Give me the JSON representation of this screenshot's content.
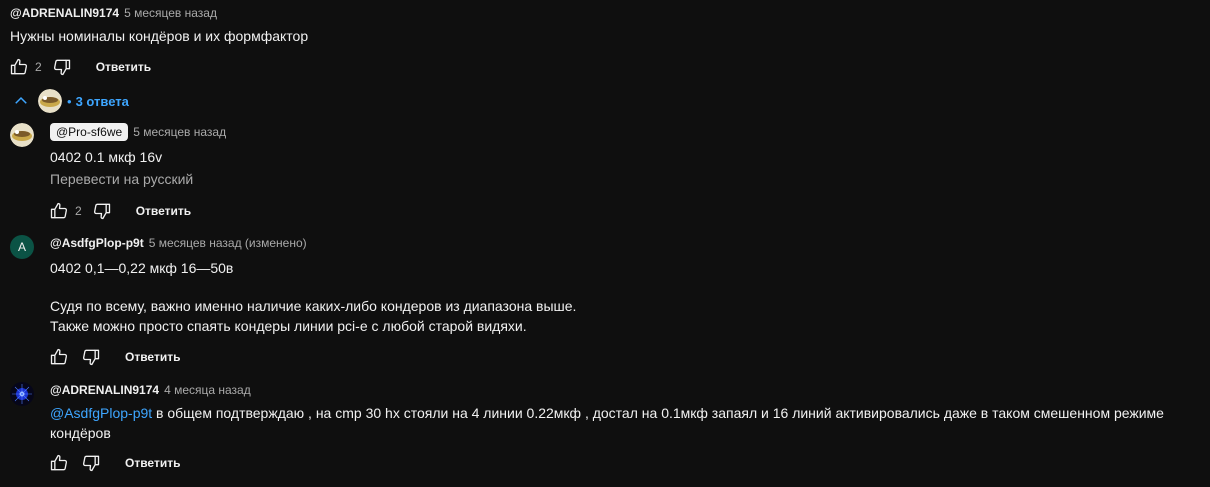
{
  "comment": {
    "author": "@ADRENALIN9174",
    "time": "5 месяцев назад",
    "text": "Нужны номиналы кондёров и их формфактор",
    "likes": "2",
    "reply_label": "Ответить"
  },
  "replies_toggle": {
    "bullet": "•",
    "label": "3 ответа"
  },
  "replies": [
    {
      "author": "@Pro-sf6we",
      "time": "5 месяцев назад",
      "text": "0402 0.1 мкф 16v",
      "translate": "Перевести на русский",
      "likes": "2",
      "reply_label": "Ответить"
    },
    {
      "avatar_letter": "A",
      "author": "@AsdfgPlop-p9t",
      "time": "5 месяцев назад (изменено)",
      "lines": [
        "0402 0,1—0,22 мкф 16—50в",
        "Судя по всему, важно именно наличие каких-либо кондеров из диапазона выше.",
        "Также можно просто спаять кондеры линии pci-e с любой старой видяхи."
      ],
      "reply_label": "Ответить"
    },
    {
      "author": "@ADRENALIN9174",
      "time": "4 месяца назад",
      "mention": "@AsdfgPlop-p9t",
      "text_line1": " в общем подтверждаю , на cmp 30 hx стояли на 4 линии 0.22мкф , достал на 0.1мкф запаял и 16 линий активировались  даже в таком смешенном режиме",
      "text_line2": "кондёров",
      "reply_label": "Ответить"
    }
  ],
  "colors": {
    "background": "#0f0f0f",
    "text": "#f1f1f1",
    "secondary": "#aaaaaa",
    "link": "#3ea6ff",
    "avatar_a": "#0b5345"
  },
  "icons": [
    "like-icon",
    "dislike-icon",
    "chevron-up-icon"
  ]
}
